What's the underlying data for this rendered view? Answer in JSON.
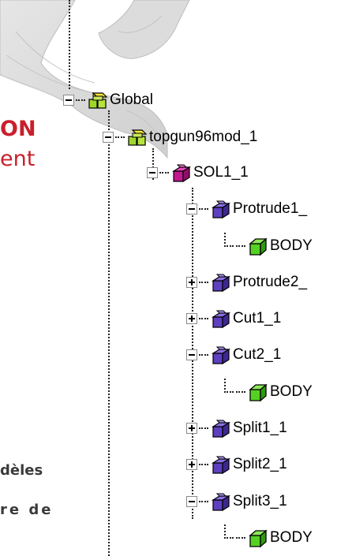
{
  "background_text": {
    "title_fragment": "ON",
    "subtitle_fragment": "ent",
    "line1_fragment": "dèles",
    "line2_fragment": "re  de"
  },
  "colors": {
    "title_red": "#c8202c",
    "body_gray": "#3a3a3a",
    "tree_line": "#222222",
    "icon_green": "#9fd62a",
    "icon_magenta": "#c0198f",
    "icon_purple": "#5e3fbf",
    "body_green": "#55d124"
  },
  "tree": {
    "nodes": [
      {
        "label": "Global",
        "toggle": "minus",
        "icon": "assembly-yellow-green-icon"
      },
      {
        "label": "topgun96mod_1",
        "toggle": "minus",
        "icon": "assembly-yellow-green-icon"
      },
      {
        "label": "SOL1_1",
        "toggle": "minus",
        "icon": "solid-magenta-icon"
      },
      {
        "label": "Protrude1_",
        "toggle": "minus",
        "icon": "feature-purple-icon"
      },
      {
        "label": "BODY",
        "toggle": "none",
        "icon": "body-green-cube-icon"
      },
      {
        "label": "Protrude2_",
        "toggle": "plus",
        "icon": "feature-purple-icon"
      },
      {
        "label": "Cut1_1",
        "toggle": "plus",
        "icon": "feature-purple-icon"
      },
      {
        "label": "Cut2_1",
        "toggle": "minus",
        "icon": "feature-purple-icon"
      },
      {
        "label": "BODY",
        "toggle": "none",
        "icon": "body-green-cube-icon"
      },
      {
        "label": "Split1_1",
        "toggle": "plus",
        "icon": "feature-purple-icon"
      },
      {
        "label": "Split2_1",
        "toggle": "plus",
        "icon": "feature-purple-icon"
      },
      {
        "label": "Split3_1",
        "toggle": "minus",
        "icon": "feature-purple-icon"
      },
      {
        "label": "BODY",
        "toggle": "none",
        "icon": "body-green-cube-icon"
      }
    ]
  }
}
